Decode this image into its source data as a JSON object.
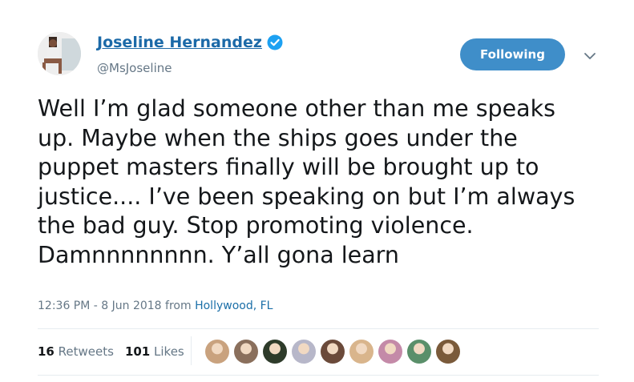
{
  "user": {
    "display_name": "Joseline Hernandez",
    "handle": "@MsJoseline",
    "verified": true
  },
  "follow_button": {
    "label": "Following"
  },
  "tweet": {
    "lines": [
      "Well I’m glad someone other than me speaks",
      "up. Maybe when the ships goes under the",
      "puppet masters finally will be brought up to",
      "justice.... I’ve been speaking on but I’m always",
      "the bad guy. Stop promoting violence.",
      "Damnnnnnnnn. Y’all gona learn"
    ]
  },
  "meta": {
    "timestamp": "12:36 PM - 8 Jun 2018",
    "from_label": "from",
    "location": "Hollywood, FL"
  },
  "stats": {
    "retweets_count": "16",
    "retweets_label": "Retweets",
    "likes_count": "101",
    "likes_label": "Likes"
  },
  "likers": [
    {
      "color": "#c9a27e"
    },
    {
      "color": "#8a6f5c"
    },
    {
      "color": "#2e3b2a"
    },
    {
      "color": "#b7b7c9"
    },
    {
      "color": "#6b4a3a"
    },
    {
      "color": "#d9b58c"
    },
    {
      "color": "#c48aa8"
    },
    {
      "color": "#5a8f6a"
    },
    {
      "color": "#7a5a3a"
    }
  ],
  "colors": {
    "accent": "#1da1f2",
    "link": "#1b6fa8",
    "button_bg": "#3f8ec9",
    "muted": "#657786"
  }
}
